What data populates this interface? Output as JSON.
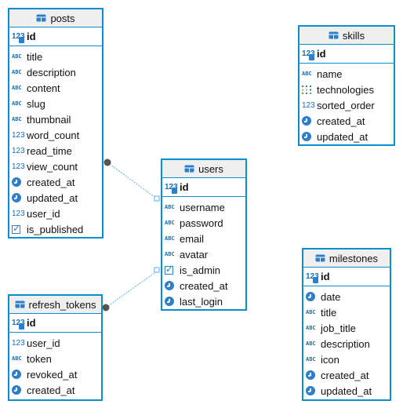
{
  "tables": {
    "posts": {
      "name": "posts",
      "pk": "id",
      "columns": [
        {
          "name": "title",
          "type_icon": "text-icon"
        },
        {
          "name": "description",
          "type_icon": "text-icon"
        },
        {
          "name": "content",
          "type_icon": "text-icon"
        },
        {
          "name": "slug",
          "type_icon": "text-icon"
        },
        {
          "name": "thumbnail",
          "type_icon": "text-icon"
        },
        {
          "name": "word_count",
          "type_icon": "number-icon"
        },
        {
          "name": "read_time",
          "type_icon": "number-icon"
        },
        {
          "name": "view_count",
          "type_icon": "number-icon"
        },
        {
          "name": "created_at",
          "type_icon": "clock-icon"
        },
        {
          "name": "updated_at",
          "type_icon": "clock-icon"
        },
        {
          "name": "user_id",
          "type_icon": "number-icon"
        },
        {
          "name": "is_published",
          "type_icon": "checkbox-icon"
        }
      ]
    },
    "skills": {
      "name": "skills",
      "pk": "id",
      "columns": [
        {
          "name": "name",
          "type_icon": "text-icon"
        },
        {
          "name": "technologies",
          "type_icon": "array-icon"
        },
        {
          "name": "sorted_order",
          "type_icon": "number-icon"
        },
        {
          "name": "created_at",
          "type_icon": "clock-icon"
        },
        {
          "name": "updated_at",
          "type_icon": "clock-icon"
        }
      ]
    },
    "users": {
      "name": "users",
      "pk": "id",
      "columns": [
        {
          "name": "username",
          "type_icon": "text-icon"
        },
        {
          "name": "password",
          "type_icon": "text-icon"
        },
        {
          "name": "email",
          "type_icon": "text-icon"
        },
        {
          "name": "avatar",
          "type_icon": "text-icon"
        },
        {
          "name": "is_admin",
          "type_icon": "checkbox-icon"
        },
        {
          "name": "created_at",
          "type_icon": "clock-icon"
        },
        {
          "name": "last_login",
          "type_icon": "clock-icon"
        }
      ]
    },
    "refresh_tokens": {
      "name": "refresh_tokens",
      "pk": "id",
      "columns": [
        {
          "name": "user_id",
          "type_icon": "number-icon"
        },
        {
          "name": "token",
          "type_icon": "text-icon"
        },
        {
          "name": "revoked_at",
          "type_icon": "clock-icon"
        },
        {
          "name": "created_at",
          "type_icon": "clock-icon"
        }
      ]
    },
    "milestones": {
      "name": "milestones",
      "pk": "id",
      "columns": [
        {
          "name": "date",
          "type_icon": "clock-icon"
        },
        {
          "name": "title",
          "type_icon": "text-icon"
        },
        {
          "name": "job_title",
          "type_icon": "text-icon"
        },
        {
          "name": "description",
          "type_icon": "text-icon"
        },
        {
          "name": "icon",
          "type_icon": "text-icon"
        },
        {
          "name": "created_at",
          "type_icon": "clock-icon"
        },
        {
          "name": "updated_at",
          "type_icon": "clock-icon"
        }
      ]
    }
  },
  "relationships": [
    {
      "from": "posts",
      "to": "users"
    },
    {
      "from": "refresh_tokens",
      "to": "users"
    }
  ],
  "icon_labels": {
    "text": "ABC",
    "number": "123",
    "array": "⁝⁝⁝"
  },
  "colors": {
    "border": "#0a8ed1",
    "header_bg": "#efefef",
    "icon": "#2d7fc9",
    "link": "#5aaee0"
  }
}
